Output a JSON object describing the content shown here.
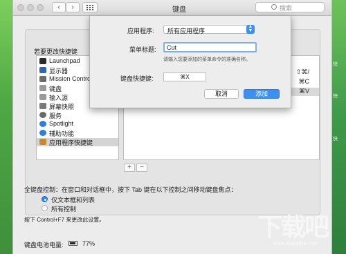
{
  "window": {
    "title": "键盘",
    "search_placeholder": "搜索"
  },
  "prefs": {
    "prompt": "若要更改快捷键",
    "categories": [
      {
        "label": "Launchpad",
        "icon": "launchpad-icon",
        "color": "#2a2a2a"
      },
      {
        "label": "显示器",
        "icon": "display-icon",
        "color": "#2a67b8"
      },
      {
        "label": "Mission Control",
        "icon": "mission-control-icon",
        "color": "#6c6c6c"
      },
      {
        "label": "键盘",
        "icon": "keyboard-icon",
        "color": "#9a9a9a"
      },
      {
        "label": "输入源",
        "icon": "input-source-icon",
        "color": "#9a9a9a"
      },
      {
        "label": "屏幕快照",
        "icon": "screenshot-icon",
        "color": "#7a7a7a"
      },
      {
        "label": "服务",
        "icon": "services-gear-icon",
        "color": "#6a6a6a"
      },
      {
        "label": "Spotlight",
        "icon": "spotlight-icon",
        "color": "#2f7de1"
      },
      {
        "label": "辅助功能",
        "icon": "accessibility-icon",
        "color": "#2f7de1"
      },
      {
        "label": "应用程序快捷键",
        "icon": "app-shortcuts-icon",
        "color": "#c98a2b"
      }
    ],
    "shortcut_keys": [
      "⇧⌘/",
      "⌘C",
      "⌘V"
    ],
    "add_label": "+",
    "remove_label": "−",
    "full_keyboard_label": "全键盘控制：在窗口和对话框中，按下 Tab 键在以下控制之间移动键盘焦点：",
    "radio_text_boxes": "仅文本框和列表",
    "radio_all_controls": "所有控制",
    "hint": "按下 Control+F7 来更改此设置。",
    "battery_label": "键盘电池电量:",
    "battery_percent": "77%"
  },
  "sheet": {
    "app_label": "应用程序:",
    "app_value": "所有应用程序",
    "menu_title_label": "菜单标题:",
    "menu_title_value": "Cut",
    "menu_title_hint": "请输入您要添加的菜单命令的准确名称。",
    "shortcut_label": "键盘快捷键:",
    "shortcut_value": "⌘X",
    "cancel_label": "取消",
    "add_label": "添加"
  },
  "desktop": {
    "right_labels": [
      "快",
      "快",
      "快"
    ]
  },
  "watermark": {
    "text": "下载吧",
    "url": "www.xiazaiba.com"
  },
  "colors": {
    "accent": "#3d8ff0",
    "selection": "#d4d4d4"
  }
}
